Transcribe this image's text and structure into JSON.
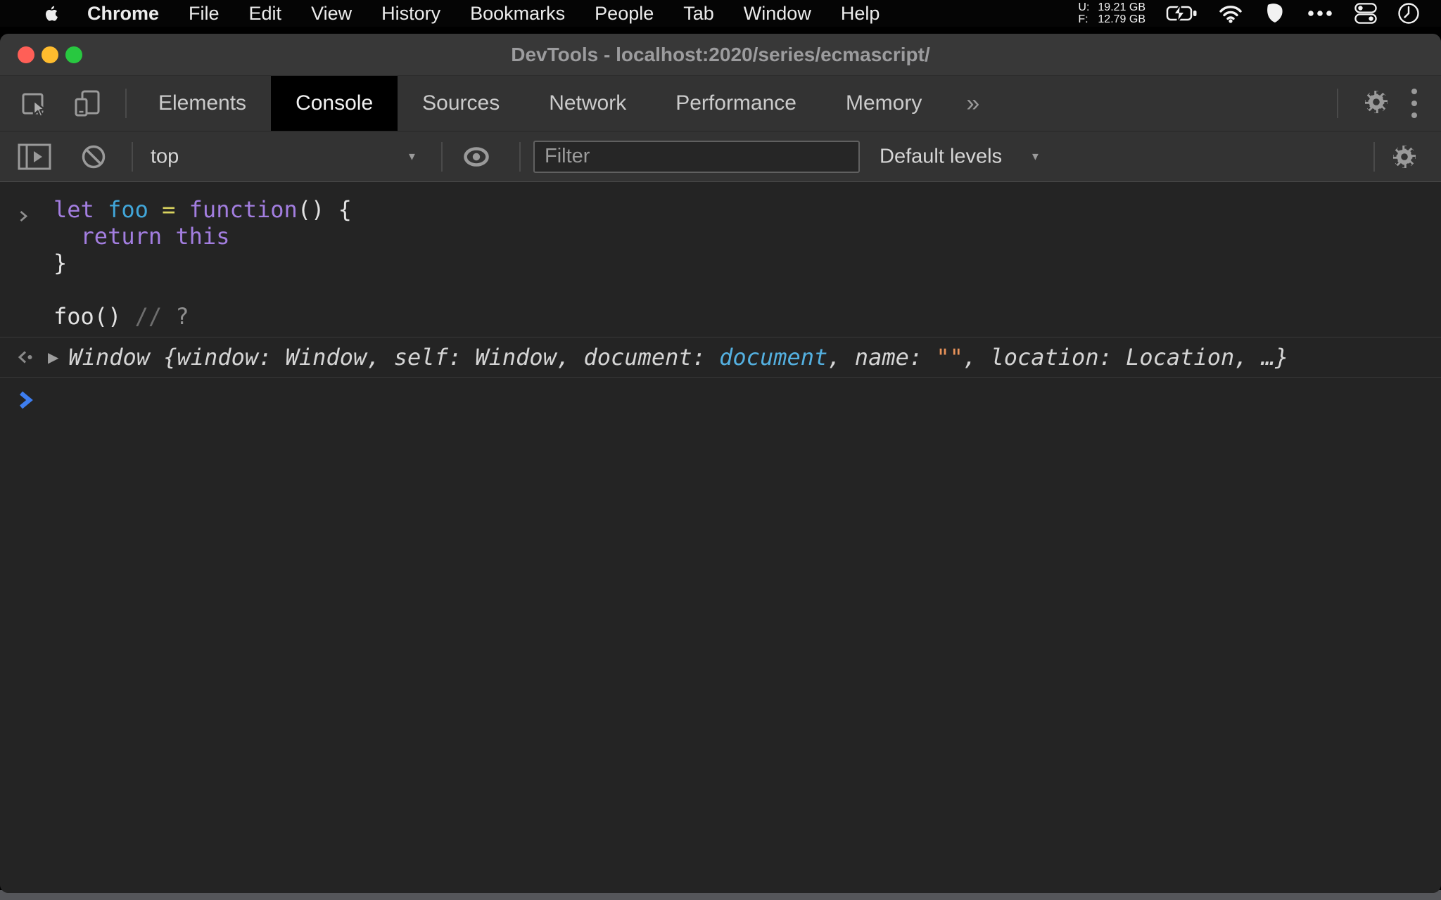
{
  "colors": {
    "accent_blue": "#3e7ef0",
    "menubar_bg": "#050505",
    "titlebar_bg": "#383838",
    "toolbar_bg": "#333333",
    "console_bg": "#242424",
    "active_tab_bg": "#000000",
    "traffic_red": "#ff5f57",
    "traffic_yellow": "#febc2e",
    "traffic_green": "#28c840",
    "syntax_keyword": "#a37ee0",
    "syntax_variable": "#41a6d9",
    "syntax_operator": "#d9d35e",
    "syntax_plain": "#e3e3e3",
    "syntax_comment": "#6e6e6e",
    "syntax_comment_q": "#8f8f8f",
    "result_text": "#d5d5d5",
    "result_blue": "#54b0e0",
    "result_orange": "#e9935a"
  },
  "menu_bar": {
    "items": [
      {
        "label": "Chrome",
        "bold": true
      },
      {
        "label": "File"
      },
      {
        "label": "Edit"
      },
      {
        "label": "View"
      },
      {
        "label": "History"
      },
      {
        "label": "Bookmarks"
      },
      {
        "label": "People"
      },
      {
        "label": "Tab"
      },
      {
        "label": "Window"
      },
      {
        "label": "Help"
      }
    ],
    "status_memory": {
      "used_label": "U:",
      "used_value": "19.21 GB",
      "free_label": "F:",
      "free_value": "12.79 GB"
    }
  },
  "window_title": "DevTools - localhost:2020/series/ecmascript/",
  "devtools": {
    "tabs": [
      {
        "label": "Elements",
        "active": false
      },
      {
        "label": "Console",
        "active": true
      },
      {
        "label": "Sources",
        "active": false
      },
      {
        "label": "Network",
        "active": false
      },
      {
        "label": "Performance",
        "active": false
      },
      {
        "label": "Memory",
        "active": false
      }
    ],
    "more_tabs_symbol": "»"
  },
  "console_toolbar": {
    "context_selector": "top",
    "filter_placeholder": "Filter",
    "levels_selector": "Default levels"
  },
  "icons": {
    "dropdown_arrow": "▼",
    "disclosure_triangle": "▶"
  },
  "console": {
    "input_lines": [
      [
        [
          "let",
          "kw"
        ],
        [
          " ",
          "pl"
        ],
        [
          "foo",
          "var"
        ],
        [
          " ",
          "pl"
        ],
        [
          "=",
          "op"
        ],
        [
          " ",
          "pl"
        ],
        [
          "function",
          "kw"
        ],
        [
          "() {",
          "pl"
        ]
      ],
      [
        [
          "  ",
          "pl"
        ],
        [
          "return",
          "kw"
        ],
        [
          " ",
          "pl"
        ],
        [
          "this",
          "kw"
        ]
      ],
      [
        [
          "}",
          "pl"
        ]
      ],
      [],
      [
        [
          "foo() ",
          "pl"
        ],
        [
          "//",
          "cm"
        ],
        [
          " ",
          "cmq"
        ],
        [
          "?",
          "cmq"
        ]
      ]
    ],
    "result_tokens": [
      [
        "Window {window: Window, self: Window, document: ",
        "res"
      ],
      [
        "document",
        "resblue"
      ],
      [
        ", name: ",
        "res"
      ],
      [
        "\"\"",
        "resorange"
      ],
      [
        ", location: Location, …}",
        "res"
      ]
    ]
  }
}
